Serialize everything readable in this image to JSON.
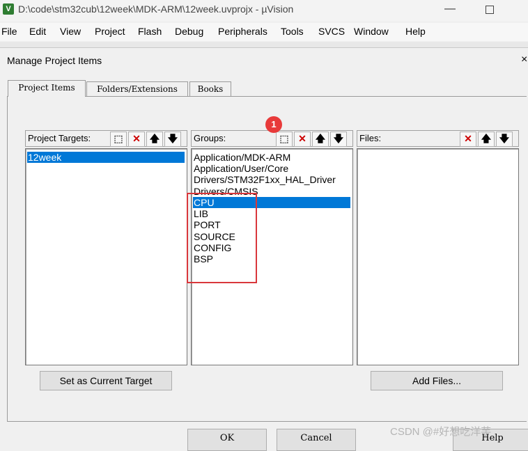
{
  "window": {
    "title": "D:\\code\\stm32cub\\12week\\MDK-ARM\\12week.uvprojx - µVision",
    "icon_label": "V",
    "minimize_icon": "minimize-icon",
    "maximize_icon": "maximize-icon"
  },
  "menu": [
    "File",
    "Edit",
    "View",
    "Project",
    "Flash",
    "Debug",
    "Peripherals",
    "Tools",
    "SVCS",
    "Window",
    "Help"
  ],
  "dialog": {
    "title": "Manage Project Items",
    "close_glyph": "×",
    "tabs": [
      "Project Items",
      "Folders/Extensions",
      "Books"
    ],
    "active_tab": 0
  },
  "targets": {
    "label": "Project Targets:",
    "items": [
      "12week"
    ],
    "selected": 0,
    "button": "Set as Current Target"
  },
  "groups": {
    "label": "Groups:",
    "items": [
      "Application/MDK-ARM",
      "Application/User/Core",
      "Drivers/STM32F1xx_HAL_Driver",
      "Drivers/CMSIS",
      "CPU",
      "LIB",
      "PORT",
      "SOURCE",
      "CONFIG",
      "BSP"
    ],
    "selected": 4
  },
  "files": {
    "label": "Files:",
    "items": [],
    "button": "Add Files..."
  },
  "toolbar_glyphs": {
    "new": "⬚",
    "delete": "✕",
    "up": "🡅",
    "down": "🡇"
  },
  "footer": {
    "ok": "OK",
    "cancel": "Cancel",
    "help": "Help"
  },
  "annotation": {
    "badge": "1",
    "color": "#d9373b"
  },
  "watermark": "CSDN @#好想吃洋芋",
  "colors": {
    "selection": "#0078d7",
    "delete_icon": "#cc0000"
  }
}
